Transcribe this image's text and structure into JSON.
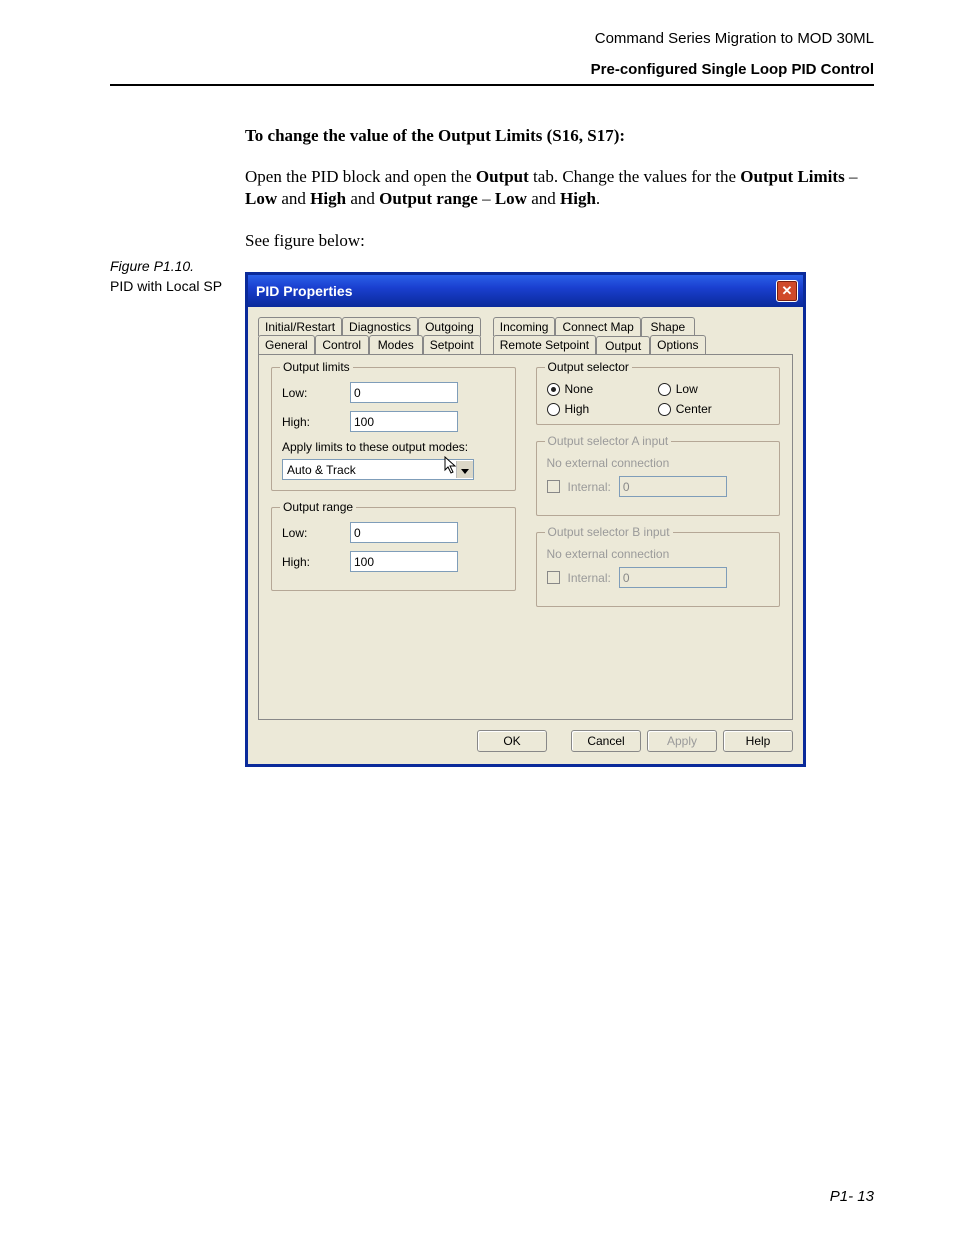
{
  "header": {
    "doc_title": "Command Series Migration to MOD 30ML",
    "section_title": "Pre-configured Single Loop PID Control"
  },
  "instructions": {
    "heading": "To change the value of the Output Limits (S16, S17):",
    "p1_a": "Open the PID block and open the ",
    "p1_b": "Output",
    "p1_c": " tab. Change the values for the ",
    "p1_d": "Output Limits",
    "p1_e": " – ",
    "p1_f": "Low",
    "p1_g": " and ",
    "p1_h": "High",
    "p1_i": " and ",
    "p1_j": "Output range",
    "p1_k": " – ",
    "p1_l": "Low",
    "p1_m": " and ",
    "p1_n": "High",
    "p1_o": ".",
    "see_fig": "See figure below:"
  },
  "figure": {
    "number": "Figure P1.10.",
    "caption": "PID with Local SP"
  },
  "window": {
    "title": "PID Properties",
    "tabs_row1": [
      "Initial/Restart",
      "Diagnostics",
      "Outgoing",
      "Incoming",
      "Connect Map",
      "Shape"
    ],
    "tabs_row2": [
      "General",
      "Control",
      "Modes",
      "Setpoint",
      "Remote Setpoint",
      "Output",
      "Options"
    ],
    "active_tab": "Output",
    "output_limits": {
      "legend": "Output limits",
      "low_label": "Low:",
      "low_value": "0",
      "high_label": "High:",
      "high_value": "100",
      "apply_label": "Apply limits to these output modes:",
      "apply_value": "Auto & Track"
    },
    "output_range": {
      "legend": "Output range",
      "low_label": "Low:",
      "low_value": "0",
      "high_label": "High:",
      "high_value": "100"
    },
    "output_selector": {
      "legend": "Output selector",
      "options": [
        "None",
        "Low",
        "High",
        "Center"
      ],
      "selected": "None"
    },
    "selector_a": {
      "legend": "Output selector A input",
      "text": "No external connection",
      "internal_label": "Internal:",
      "internal_value": "0"
    },
    "selector_b": {
      "legend": "Output selector B input",
      "text": "No external connection",
      "internal_label": "Internal:",
      "internal_value": "0"
    },
    "buttons": {
      "ok": "OK",
      "cancel": "Cancel",
      "apply": "Apply",
      "help": "Help"
    }
  },
  "page_number": "P1- 13"
}
